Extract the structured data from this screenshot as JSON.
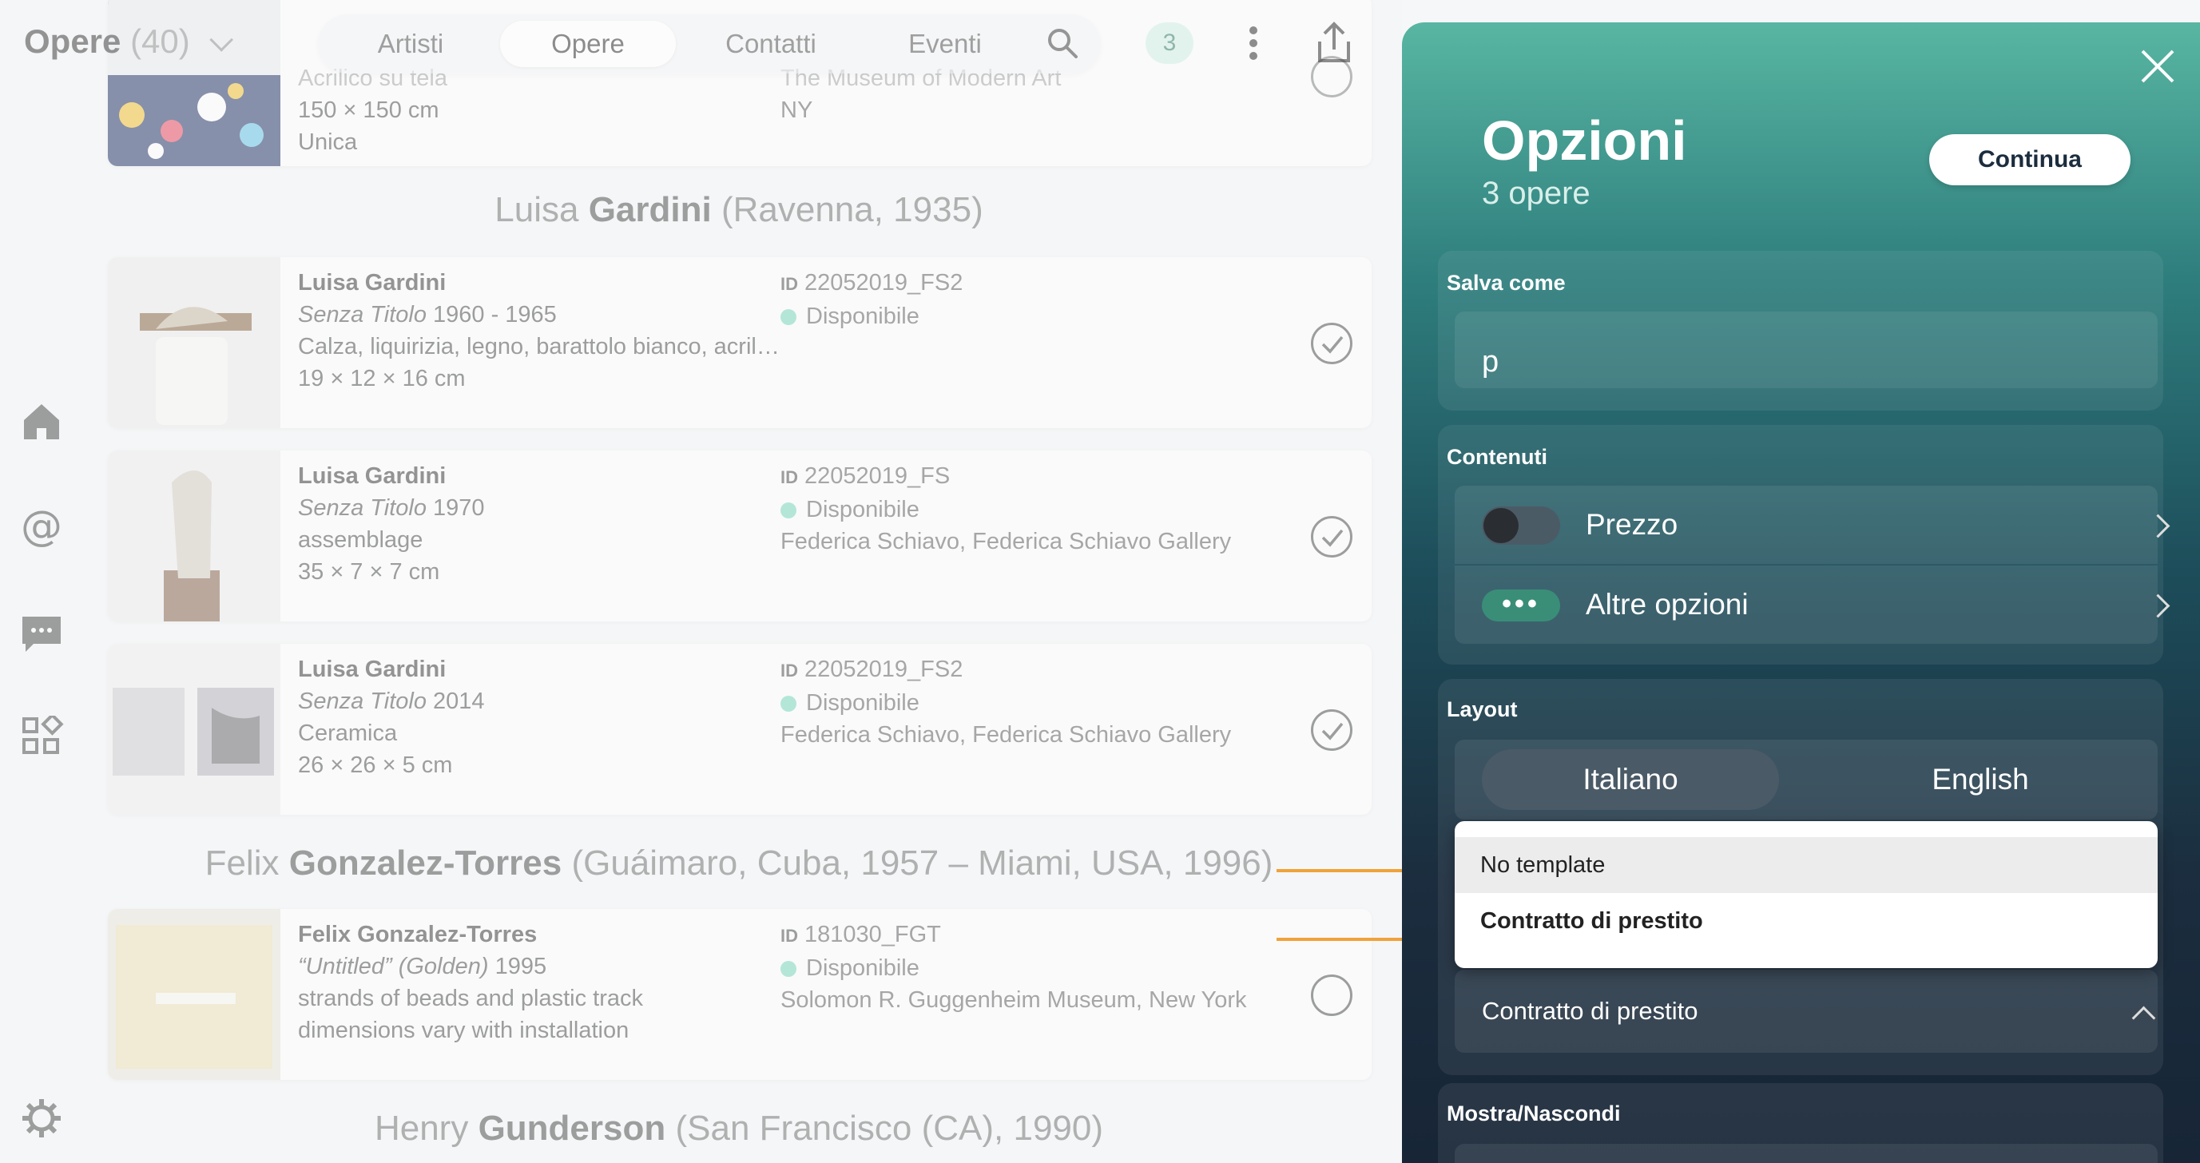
{
  "header": {
    "title": "Opere",
    "count": "(40)",
    "tabs": [
      "Artisti",
      "Opere",
      "Contatti",
      "Eventi"
    ],
    "active_tab": "Opere",
    "badge": "3"
  },
  "top_card": {
    "line1": "Acrilico su tela",
    "size": "150 × 150 cm",
    "edition": "Unica",
    "meta1": "The Museum of Modern Art",
    "meta2": "NY"
  },
  "groups": [
    {
      "first": "Luisa",
      "last": "Gardini",
      "info": "(Ravenna, 1935)"
    },
    {
      "first": "Felix",
      "last": "Gonzalez-Torres",
      "info": "(Guáimaro, Cuba, 1957 – Miami, USA, 1996)"
    },
    {
      "first": "Henry",
      "last": "Gunderson",
      "info": "(San Francisco (CA), 1990)"
    }
  ],
  "works": [
    {
      "artist": "Luisa Gardini",
      "title": "Senza Titolo",
      "year": " 1960 - 1965",
      "medium": "Calza, liquirizia, legno, barattolo bianco, acril…",
      "size": "19 × 12 × 16 cm",
      "id_label": "ID",
      "id": "22052019_FS2",
      "status": "Disponibile",
      "location": "",
      "checked": true
    },
    {
      "artist": "Luisa Gardini",
      "title": "Senza Titolo",
      "year": " 1970",
      "medium": "assemblage",
      "size": "35 × 7 × 7 cm",
      "id_label": "ID",
      "id": "22052019_FS",
      "status": "Disponibile",
      "location": "Federica Schiavo, Federica Schiavo Gallery",
      "checked": true
    },
    {
      "artist": "Luisa Gardini",
      "title": "Senza Titolo",
      "year": " 2014",
      "medium": "Ceramica",
      "size": "26 × 26 × 5 cm",
      "id_label": "ID",
      "id": "22052019_FS2",
      "status": "Disponibile",
      "location": "Federica Schiavo, Federica Schiavo Gallery",
      "checked": true
    },
    {
      "artist": "Felix Gonzalez-Torres",
      "title": "“Untitled” (Golden)",
      "year": " 1995",
      "medium": "strands of beads and plastic track",
      "size": "dimensions vary with installation",
      "id_label": "ID",
      "id": "181030_FGT",
      "status": "Disponibile",
      "location": "Solomon R. Guggenheim Museum, New York",
      "checked": false
    }
  ],
  "panel": {
    "title": "Opzioni",
    "subtitle": "3 opere",
    "continue_label": "Continua",
    "save_as_label": "Salva come",
    "save_as_value": "p",
    "contents_label": "Contenuti",
    "price_label": "Prezzo",
    "other_options_label": "Altre opzioni",
    "dots": "•••",
    "layout_label": "Layout",
    "languages": [
      "Italiano",
      "English"
    ],
    "active_language": "Italiano",
    "template_options": [
      "No template",
      "Contratto di prestito"
    ],
    "selected_template": "Contratto di prestito",
    "show_hide_label": "Mostra/Nascondi"
  },
  "colors": {
    "accent_teal": "#58b6a2",
    "panel_dark": "#1b2d3e",
    "status_dot": "#7fd9bd",
    "annotation_arrow": "#f0a23a"
  }
}
